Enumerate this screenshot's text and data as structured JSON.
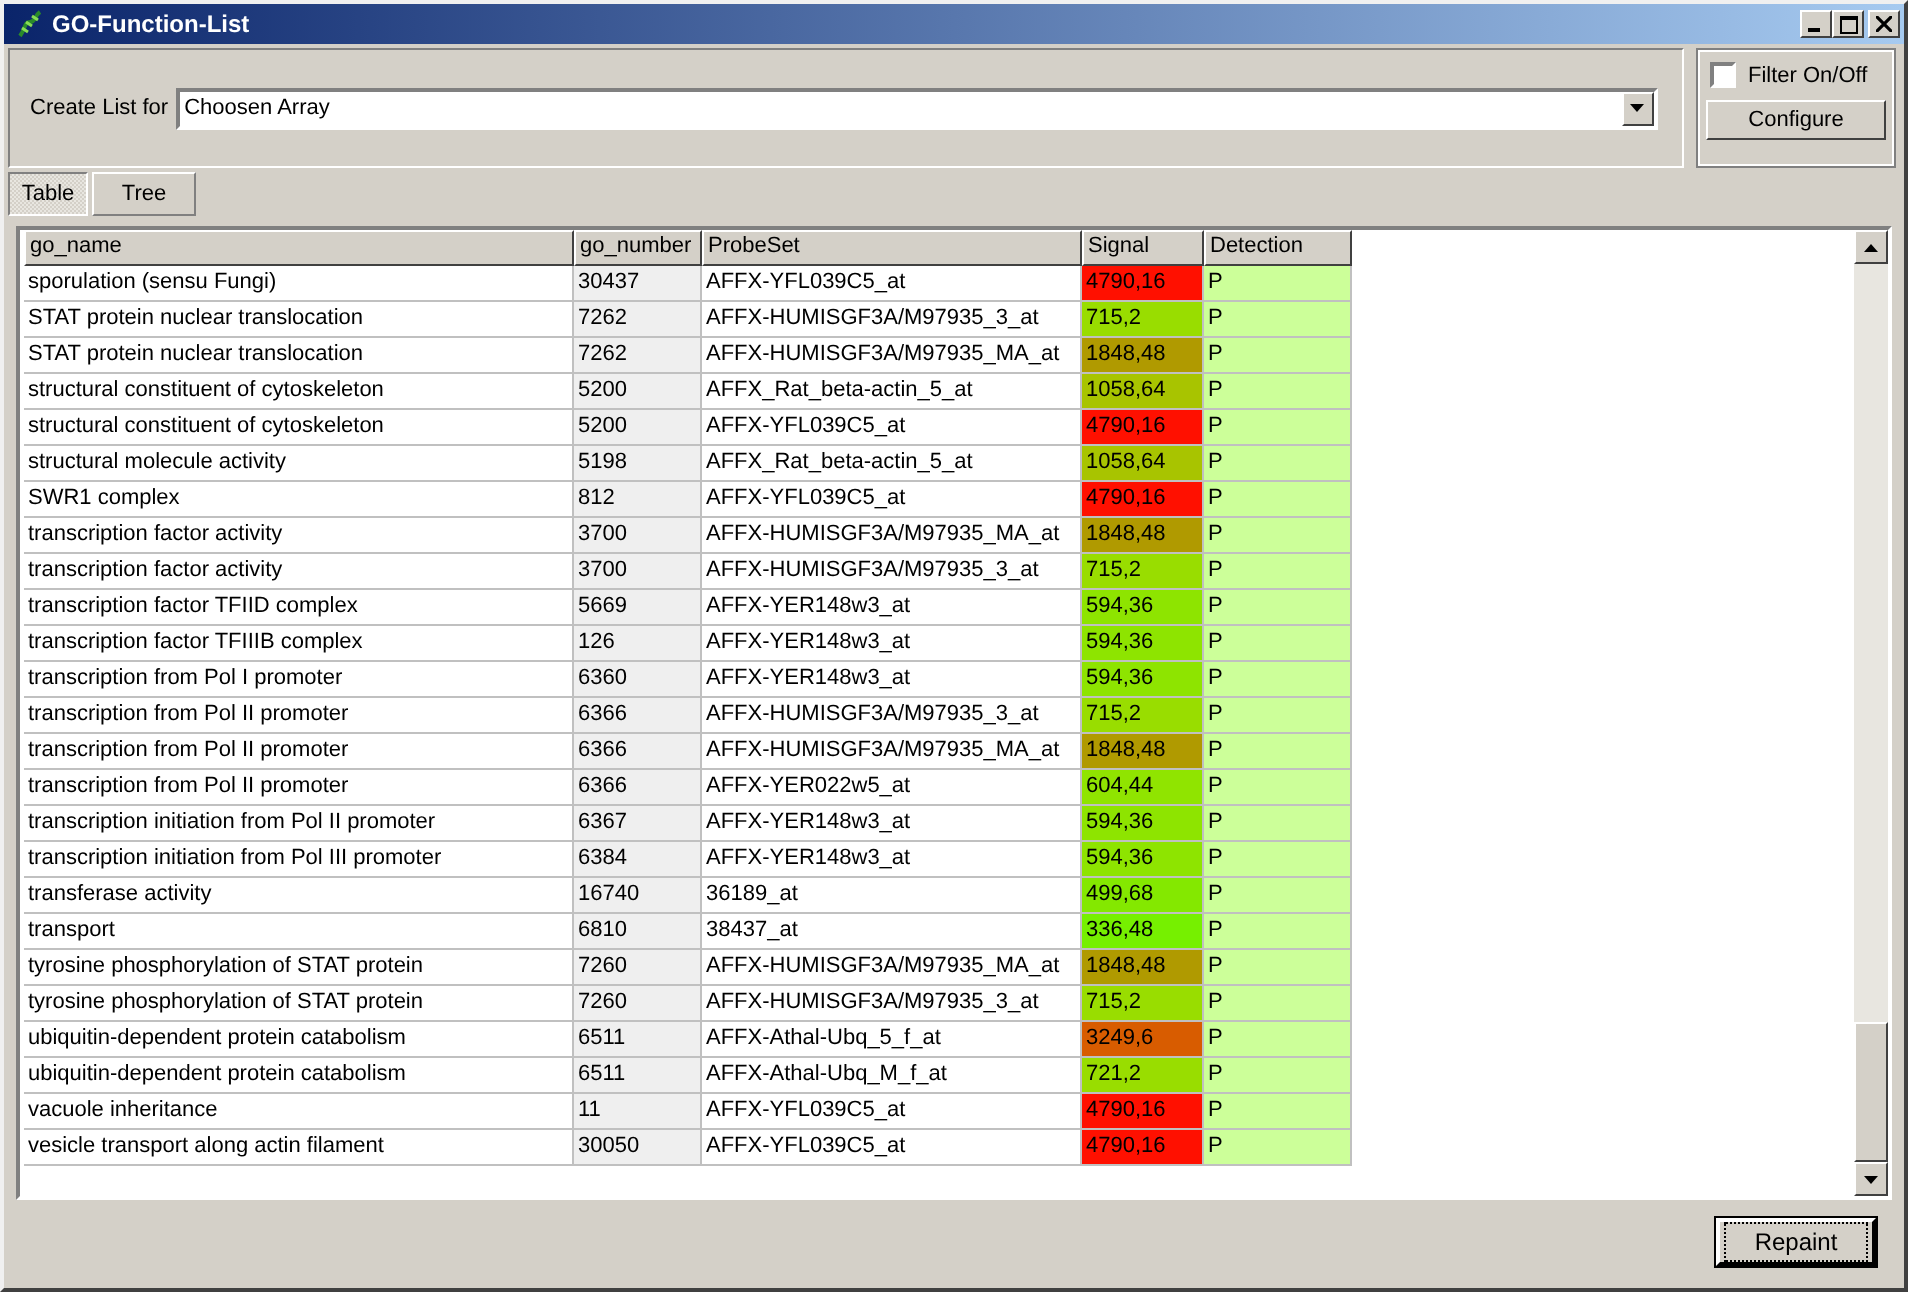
{
  "window": {
    "title": "GO-Function-List"
  },
  "create_list": {
    "label": "Create List for",
    "value": "Choosen Array"
  },
  "filter": {
    "label": "Filter On/Off",
    "checked": false,
    "button": "Configure"
  },
  "tabs": [
    {
      "label": "Table",
      "selected": true
    },
    {
      "label": "Tree",
      "selected": false
    }
  ],
  "table": {
    "columns": [
      "go_name",
      "go_number",
      "ProbeSet",
      "Signal",
      "Detection"
    ],
    "rows": [
      {
        "go_name": "sporulation (sensu Fungi)",
        "go_number": "30437",
        "probeset": "AFFX-YFL039C5_at",
        "signal": "4790,16",
        "color": "#ff1000",
        "detection": "P"
      },
      {
        "go_name": "STAT protein nuclear translocation",
        "go_number": "7262",
        "probeset": "AFFX-HUMISGF3A/M97935_3_at",
        "signal": "715,2",
        "color": "#99dd00",
        "detection": "P"
      },
      {
        "go_name": "STAT protein nuclear translocation",
        "go_number": "7262",
        "probeset": "AFFX-HUMISGF3A/M97935_MA_at",
        "signal": "1848,48",
        "color": "#b09a00",
        "detection": "P"
      },
      {
        "go_name": "structural constituent of cytoskeleton",
        "go_number": "5200",
        "probeset": "AFFX_Rat_beta-actin_5_at",
        "signal": "1058,64",
        "color": "#a8c400",
        "detection": "P"
      },
      {
        "go_name": "structural constituent of cytoskeleton",
        "go_number": "5200",
        "probeset": "AFFX-YFL039C5_at",
        "signal": "4790,16",
        "color": "#ff1000",
        "detection": "P"
      },
      {
        "go_name": "structural molecule activity",
        "go_number": "5198",
        "probeset": "AFFX_Rat_beta-actin_5_at",
        "signal": "1058,64",
        "color": "#a8c400",
        "detection": "P"
      },
      {
        "go_name": "SWR1 complex",
        "go_number": "812",
        "probeset": "AFFX-YFL039C5_at",
        "signal": "4790,16",
        "color": "#ff1000",
        "detection": "P"
      },
      {
        "go_name": "transcription factor activity",
        "go_number": "3700",
        "probeset": "AFFX-HUMISGF3A/M97935_MA_at",
        "signal": "1848,48",
        "color": "#b09a00",
        "detection": "P"
      },
      {
        "go_name": "transcription factor activity",
        "go_number": "3700",
        "probeset": "AFFX-HUMISGF3A/M97935_3_at",
        "signal": "715,2",
        "color": "#99dd00",
        "detection": "P"
      },
      {
        "go_name": "transcription factor TFIID complex",
        "go_number": "5669",
        "probeset": "AFFX-YER148w3_at",
        "signal": "594,36",
        "color": "#8ee400",
        "detection": "P"
      },
      {
        "go_name": "transcription factor TFIIIB complex",
        "go_number": "126",
        "probeset": "AFFX-YER148w3_at",
        "signal": "594,36",
        "color": "#8ee400",
        "detection": "P"
      },
      {
        "go_name": "transcription from Pol I promoter",
        "go_number": "6360",
        "probeset": "AFFX-YER148w3_at",
        "signal": "594,36",
        "color": "#8ee400",
        "detection": "P"
      },
      {
        "go_name": "transcription from Pol II promoter",
        "go_number": "6366",
        "probeset": "AFFX-HUMISGF3A/M97935_3_at",
        "signal": "715,2",
        "color": "#99dd00",
        "detection": "P"
      },
      {
        "go_name": "transcription from Pol II promoter",
        "go_number": "6366",
        "probeset": "AFFX-HUMISGF3A/M97935_MA_at",
        "signal": "1848,48",
        "color": "#b09a00",
        "detection": "P"
      },
      {
        "go_name": "transcription from Pol II promoter",
        "go_number": "6366",
        "probeset": "AFFX-YER022w5_at",
        "signal": "604,44",
        "color": "#90e400",
        "detection": "P"
      },
      {
        "go_name": "transcription initiation from Pol II promoter",
        "go_number": "6367",
        "probeset": "AFFX-YER148w3_at",
        "signal": "594,36",
        "color": "#8ee400",
        "detection": "P"
      },
      {
        "go_name": "transcription initiation from Pol III promoter",
        "go_number": "6384",
        "probeset": "AFFX-YER148w3_at",
        "signal": "594,36",
        "color": "#8ee400",
        "detection": "P"
      },
      {
        "go_name": "transferase activity",
        "go_number": "16740",
        "probeset": "36189_at",
        "signal": "499,68",
        "color": "#84e800",
        "detection": "P"
      },
      {
        "go_name": "transport",
        "go_number": "6810",
        "probeset": "38437_at",
        "signal": "336,48",
        "color": "#76f000",
        "detection": "P"
      },
      {
        "go_name": "tyrosine phosphorylation of STAT protein",
        "go_number": "7260",
        "probeset": "AFFX-HUMISGF3A/M97935_MA_at",
        "signal": "1848,48",
        "color": "#b09a00",
        "detection": "P"
      },
      {
        "go_name": "tyrosine phosphorylation of STAT protein",
        "go_number": "7260",
        "probeset": "AFFX-HUMISGF3A/M97935_3_at",
        "signal": "715,2",
        "color": "#99dd00",
        "detection": "P"
      },
      {
        "go_name": "ubiquitin-dependent protein catabolism",
        "go_number": "6511",
        "probeset": "AFFX-Athal-Ubq_5_f_at",
        "signal": "3249,6",
        "color": "#d85c00",
        "detection": "P"
      },
      {
        "go_name": "ubiquitin-dependent protein catabolism",
        "go_number": "6511",
        "probeset": "AFFX-Athal-Ubq_M_f_at",
        "signal": "721,2",
        "color": "#99dd00",
        "detection": "P"
      },
      {
        "go_name": "vacuole inheritance",
        "go_number": "11",
        "probeset": "AFFX-YFL039C5_at",
        "signal": "4790,16",
        "color": "#ff1000",
        "detection": "P"
      },
      {
        "go_name": "vesicle transport along actin filament",
        "go_number": "30050",
        "probeset": "AFFX-YFL039C5_at",
        "signal": "4790,16",
        "color": "#ff1000",
        "detection": "P"
      }
    ]
  },
  "buttons": [
    "Repaint"
  ]
}
